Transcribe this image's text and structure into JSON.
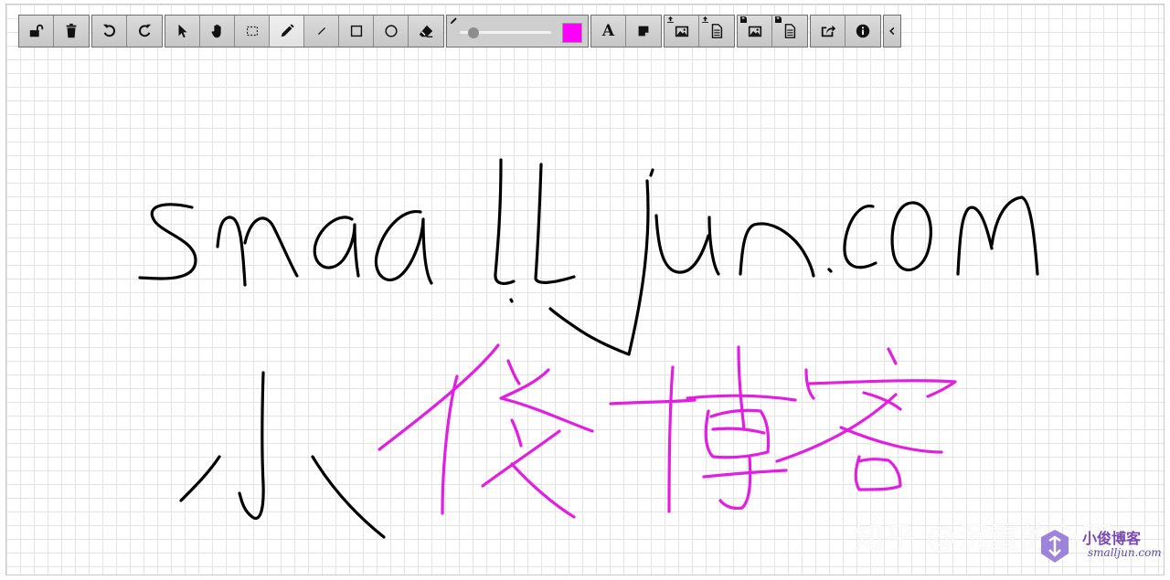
{
  "toolbar": {
    "groups": [
      [
        "lock-open",
        "trash"
      ],
      [
        "undo",
        "redo"
      ],
      [
        "select-pointer",
        "pan-hand",
        "marquee-select",
        "pencil",
        "line",
        "rectangle",
        "ellipse",
        "eraser"
      ],
      [
        "style-slider"
      ],
      [
        "text",
        "sticky-note"
      ],
      [
        "import-image",
        "import-document"
      ],
      [
        "save-image",
        "save-document"
      ],
      [
        "share-export",
        "info"
      ],
      [
        "collapse"
      ]
    ],
    "text_button_label": "A",
    "active_tool": "pencil",
    "stroke_size_level": 0.1,
    "stroke_color": "#ff00ff"
  },
  "drawing": {
    "ink_colors": {
      "black": "#000000",
      "magenta": "#e21ee2"
    },
    "handwritten_line1": "smalljun.com",
    "handwritten_line2": "小俊博客"
  },
  "watermark": {
    "text": "知乎 @沉重的心雨"
  },
  "logo": {
    "title": "小俊博客",
    "url": "smalljun.com",
    "color": "#7a4bb0"
  }
}
